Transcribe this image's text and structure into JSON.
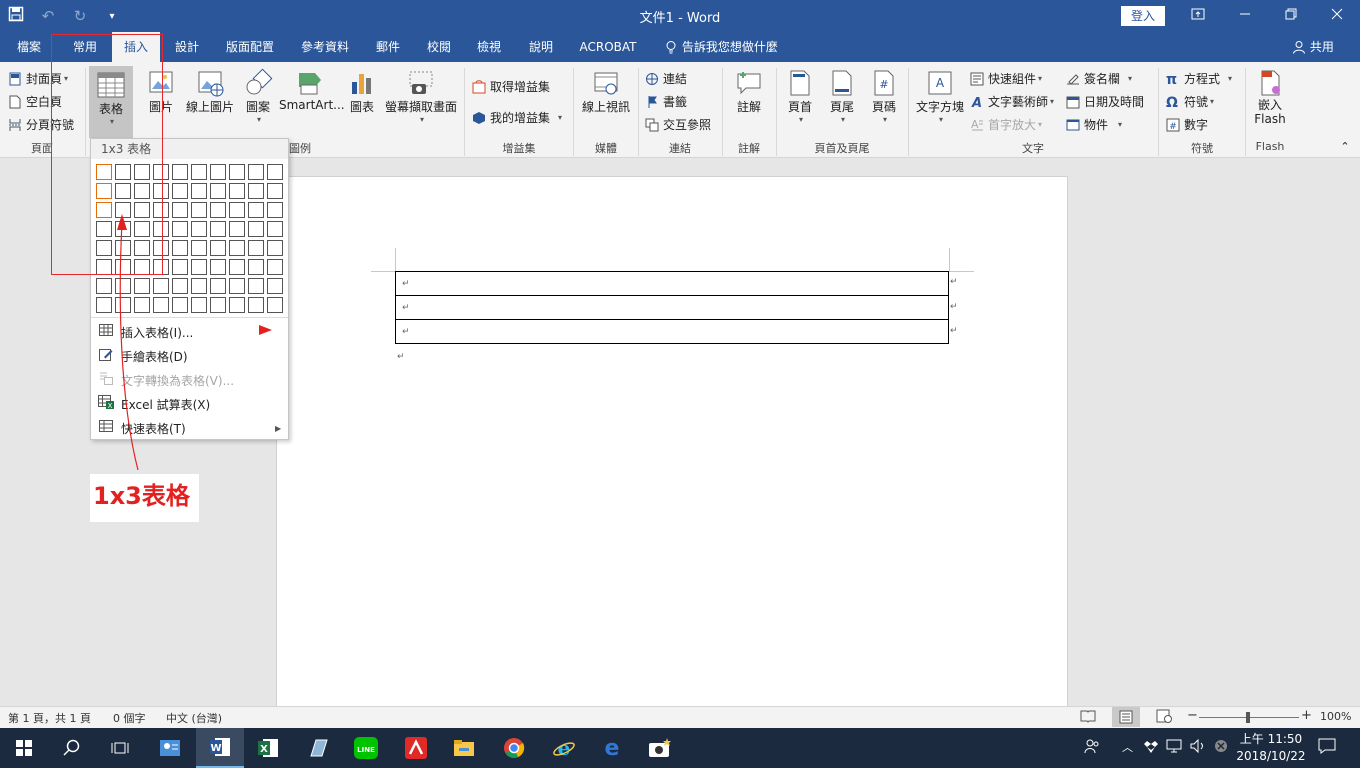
{
  "title_bar": {
    "document_title": "文件1 - Word",
    "sign_in_label": "登入",
    "qat_icons": [
      "save-icon",
      "undo-icon",
      "redo-icon",
      "customize-qat-icon"
    ]
  },
  "tabs": [
    {
      "label": "檔案"
    },
    {
      "label": "常用"
    },
    {
      "label": "插入"
    },
    {
      "label": "設計"
    },
    {
      "label": "版面配置"
    },
    {
      "label": "參考資料"
    },
    {
      "label": "郵件"
    },
    {
      "label": "校閱"
    },
    {
      "label": "檢視"
    },
    {
      "label": "說明"
    },
    {
      "label": "ACROBAT"
    }
  ],
  "active_tab": "插入",
  "tell_me": "告訴我您想做什麼",
  "share_label": "共用",
  "ribbon": {
    "pages": {
      "cover": "封面頁",
      "blank": "空白頁",
      "break": "分頁符號",
      "group": "頁面"
    },
    "table": {
      "label": "表格"
    },
    "illustrations": {
      "picture": "圖片",
      "online_picture": "線上圖片",
      "shapes": "圖案",
      "smartart": "SmartArt...",
      "chart": "圖表",
      "screenshot": "螢幕擷取畫面",
      "group_tail": "圖例"
    },
    "addins": {
      "get": "取得增益集",
      "my": "我的增益集",
      "group": "增益集"
    },
    "media": {
      "online_video": "線上視訊",
      "group": "媒體"
    },
    "links": {
      "link": "連結",
      "bookmark": "書籤",
      "cross_ref": "交互參照",
      "group": "連結"
    },
    "comments": {
      "comment": "註解",
      "group": "註解"
    },
    "header_footer": {
      "header": "頁首",
      "footer": "頁尾",
      "page_number": "頁碼",
      "group": "頁首及頁尾"
    },
    "text": {
      "textbox": "文字方塊",
      "quick_parts": "快速組件",
      "wordart": "文字藝術師",
      "dropcap": "首字放大",
      "signature": "簽名欄",
      "datetime": "日期及時間",
      "object": "物件",
      "group": "文字"
    },
    "symbols": {
      "equation": "方程式",
      "symbol": "符號",
      "number": "數字",
      "group": "符號"
    },
    "flash": {
      "embed": "嵌入 Flash",
      "group": "Flash"
    }
  },
  "dropdown": {
    "header": "1x3 表格",
    "grid_cols": 10,
    "grid_rows": 8,
    "highlight_cols": 1,
    "highlight_rows": 3,
    "items": [
      {
        "label": "插入表格(I)...",
        "icon": "table-icon",
        "disabled": false
      },
      {
        "label": "手繪表格(D)",
        "icon": "pencil-table-icon",
        "disabled": false
      },
      {
        "label": "文字轉換為表格(V)...",
        "icon": "convert-text-icon",
        "disabled": true
      },
      {
        "label": "Excel 試算表(X)",
        "icon": "excel-table-icon",
        "disabled": false
      },
      {
        "label": "快速表格(T)",
        "icon": "quick-table-icon",
        "disabled": false
      }
    ]
  },
  "document": {
    "table_rows": 3,
    "cell_mark": "↵",
    "paragraph_mark": "↵"
  },
  "annotation": {
    "text": "1x3表格"
  },
  "status_bar": {
    "page": "第 1 頁，共 1 頁",
    "words": "0 個字",
    "language": "中文 (台灣)",
    "zoom": "100%"
  },
  "taskbar": {
    "time": "上午 11:50",
    "date": "2018/10/22"
  }
}
